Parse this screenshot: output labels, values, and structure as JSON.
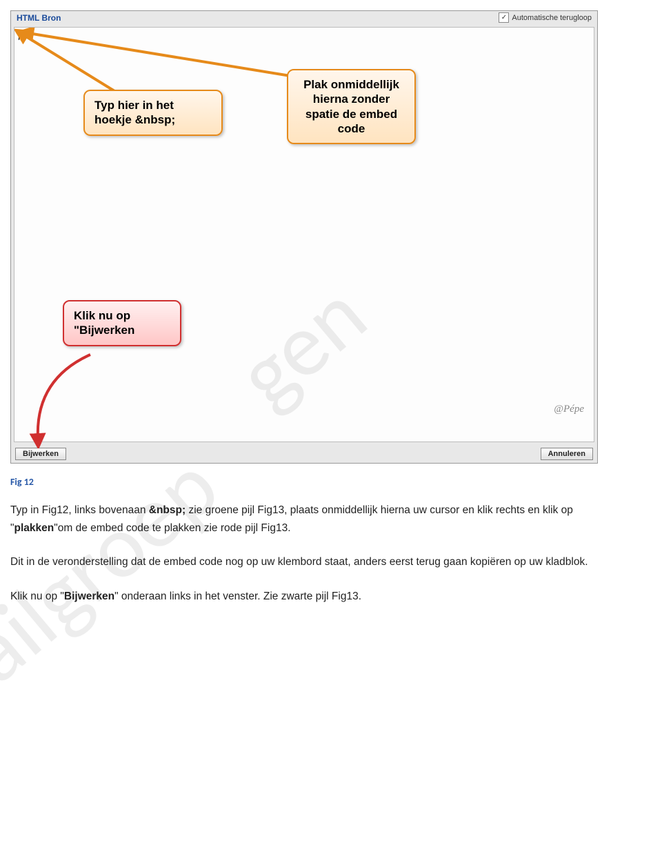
{
  "panel": {
    "title": "HTML Bron",
    "checkbox_label": "Automatische terugloop",
    "checkbox_checked": "✓",
    "btn_update": "Bijwerken",
    "btn_cancel": "Annuleren",
    "signature": "@Pépe"
  },
  "callouts": {
    "c1": "Typ hier in het hoekje &nbsp;",
    "c2": "Plak onmiddellijk hierna zonder spatie de embed code",
    "c3": "Klik nu op \"Bijwerken"
  },
  "watermark": {
    "w1": "Mailgroep",
    "w2": "gen"
  },
  "caption": "Fig 12",
  "body": {
    "p1a": "Typ in Fig12, links bovenaan ",
    "p1b": "&nbsp;",
    "p1c": " zie groene pijl Fig13, plaats onmiddellijk hierna uw cursor en klik rechts en klik op \"",
    "p1d": "plakken",
    "p1e": "\"om de embed code te plakken zie rode pijl Fig13.",
    "p2": "Dit in de veronderstelling dat de embed code nog op uw klembord staat, anders eerst terug gaan kopiëren op uw kladblok.",
    "p3a": "Klik nu op \"",
    "p3b": "Bijwerken",
    "p3c": "\" onderaan links in het venster. Zie zwarte pijl Fig13."
  }
}
